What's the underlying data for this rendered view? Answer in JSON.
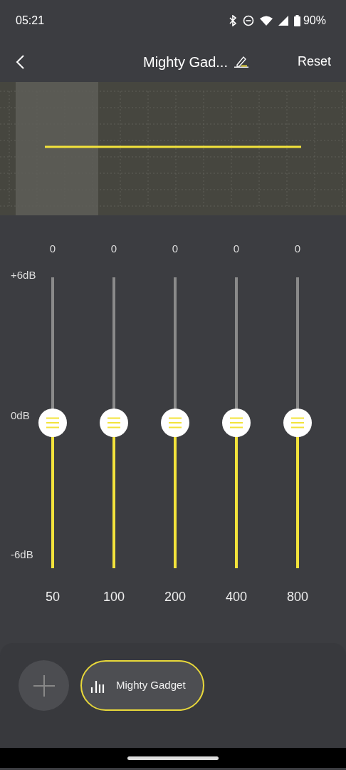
{
  "status_bar": {
    "time": "05:21",
    "battery": "90%"
  },
  "header": {
    "title": "Mighty Gad...",
    "action": "Reset"
  },
  "scale": {
    "top": "+6dB",
    "middle": "0dB",
    "bottom": "-6dB"
  },
  "sliders": [
    {
      "value": "0",
      "frequency": "50",
      "level": 0.5
    },
    {
      "value": "0",
      "frequency": "100",
      "level": 0.5
    },
    {
      "value": "0",
      "frequency": "200",
      "level": 0.5
    },
    {
      "value": "0",
      "frequency": "400",
      "level": 0.5
    },
    {
      "value": "0",
      "frequency": "800",
      "level": 0.5
    }
  ],
  "presets": [
    {
      "label": "Mighty Gadget",
      "selected": true
    }
  ]
}
